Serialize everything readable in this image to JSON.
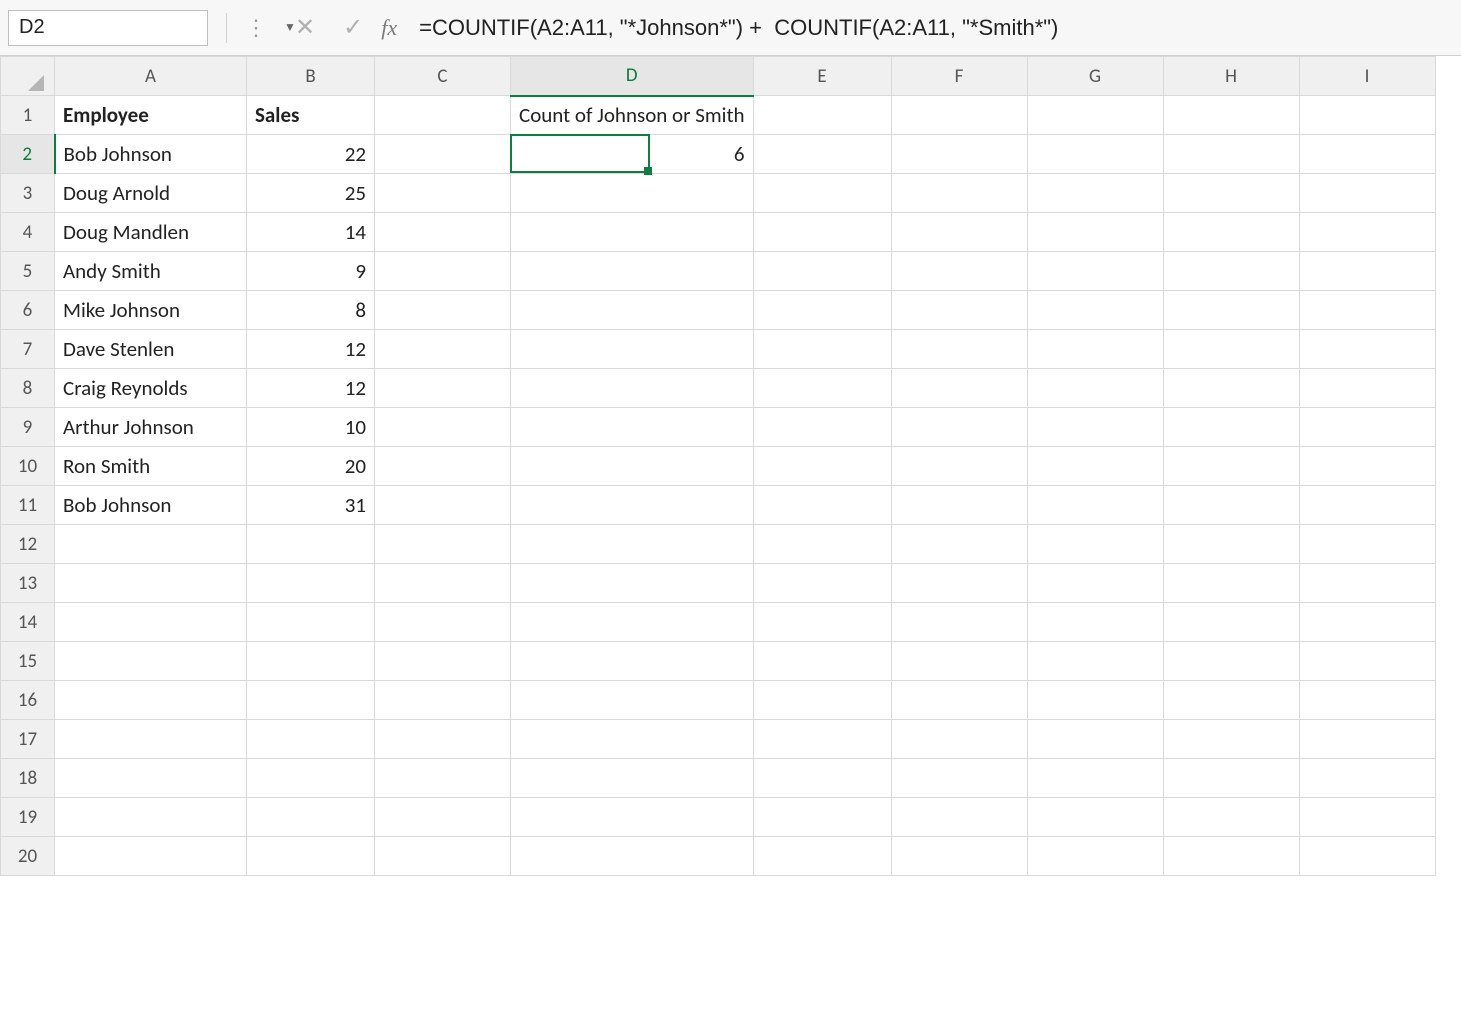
{
  "name_box": {
    "value": "D2"
  },
  "formula_bar": {
    "value": "=COUNTIF(A2:A11, \"*Johnson*\") +  COUNTIF(A2:A11, \"*Smith*\")"
  },
  "icons": {
    "cancel": "✕",
    "enter": "✓",
    "fx": "fx",
    "dropdown": "▼",
    "dots": "⋮"
  },
  "columns": [
    "A",
    "B",
    "C",
    "D",
    "E",
    "F",
    "G",
    "H",
    "I"
  ],
  "row_count": 20,
  "selected_cell": {
    "ref": "D2",
    "row": 2,
    "col": "D"
  },
  "cells": {
    "A1": {
      "v": "Employee",
      "bold": true
    },
    "B1": {
      "v": "Sales",
      "bold": true
    },
    "D1": {
      "v": "Count of  Johnson or Smith"
    },
    "A2": {
      "v": "Bob Johnson"
    },
    "B2": {
      "v": "22",
      "align": "right"
    },
    "D2": {
      "v": "6",
      "align": "right"
    },
    "A3": {
      "v": "Doug Arnold"
    },
    "B3": {
      "v": "25",
      "align": "right"
    },
    "A4": {
      "v": "Doug Mandlen"
    },
    "B4": {
      "v": "14",
      "align": "right"
    },
    "A5": {
      "v": "Andy Smith"
    },
    "B5": {
      "v": "9",
      "align": "right"
    },
    "A6": {
      "v": "Mike Johnson"
    },
    "B6": {
      "v": "8",
      "align": "right"
    },
    "A7": {
      "v": "Dave Stenlen"
    },
    "B7": {
      "v": "12",
      "align": "right"
    },
    "A8": {
      "v": "Craig Reynolds"
    },
    "B8": {
      "v": "12",
      "align": "right"
    },
    "A9": {
      "v": "Arthur Johnson"
    },
    "B9": {
      "v": "10",
      "align": "right"
    },
    "A10": {
      "v": "Ron Smith"
    },
    "B10": {
      "v": "20",
      "align": "right"
    },
    "A11": {
      "v": "Bob Johnson"
    },
    "B11": {
      "v": "31",
      "align": "right"
    }
  }
}
